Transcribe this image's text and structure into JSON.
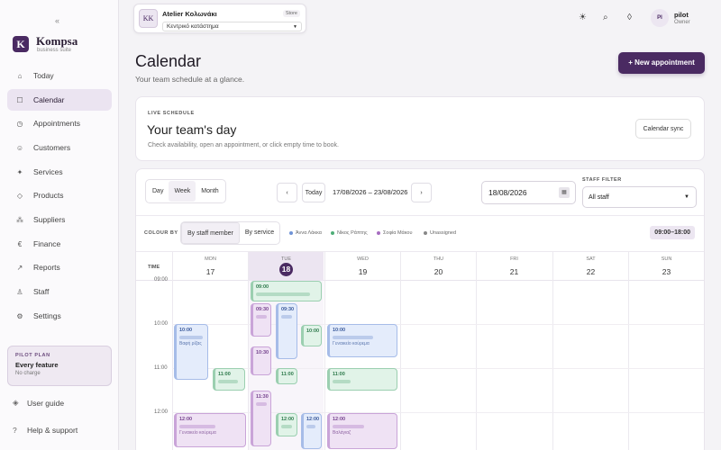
{
  "sidebar": {
    "collapse_glyph": "«",
    "logo_mark": "K",
    "brand": "Kompsa",
    "tagline": "business suite",
    "items": [
      {
        "label": "Today",
        "icon": "home-icon"
      },
      {
        "label": "Calendar",
        "icon": "calendar-icon",
        "active": true
      },
      {
        "label": "Appointments",
        "icon": "clock-icon"
      },
      {
        "label": "Customers",
        "icon": "smile-icon"
      },
      {
        "label": "Services",
        "icon": "sparkle-icon"
      },
      {
        "label": "Products",
        "icon": "box-icon"
      },
      {
        "label": "Suppliers",
        "icon": "network-icon"
      },
      {
        "label": "Finance",
        "icon": "euro-icon"
      },
      {
        "label": "Reports",
        "icon": "trend-icon"
      },
      {
        "label": "Staff",
        "icon": "user-icon"
      },
      {
        "label": "Settings",
        "icon": "gear-icon"
      }
    ],
    "plan": {
      "title": "PILOT PLAN",
      "feature": "Every feature",
      "charge": "No charge"
    },
    "footer": {
      "guide": "User guide",
      "support": "Help & support"
    }
  },
  "topbar": {
    "org_initials": "KK",
    "org_name": "Atelier Κολωνάκι",
    "org_type": "Store",
    "branch": "Κεντρικό κατάστημα",
    "user_initials": "PI",
    "user_name": "pilot",
    "user_role": "Owner"
  },
  "header": {
    "title": "Calendar",
    "subtitle": "Your team schedule at a glance.",
    "new_button": "+ New appointment"
  },
  "live": {
    "tag": "LIVE SCHEDULE",
    "title": "Your team's day",
    "subtitle": "Check availability, open an appointment, or click empty time to book.",
    "sync_button": "Calendar sync"
  },
  "calendar": {
    "views": [
      "Day",
      "Week",
      "Month"
    ],
    "active_view": "Week",
    "prev": "‹",
    "today": "Today",
    "next": "›",
    "range": "17/08/2026 – 23/08/2026",
    "date_value": "18/08/2026",
    "staff_filter_label": "STAFF FILTER",
    "staff_filter_value": "All staff",
    "colour_by_label": "COLOUR BY",
    "colour_options": [
      "By staff member",
      "By service"
    ],
    "colour_active": "By staff member",
    "legend": [
      {
        "name": "Άννα Λάκκα",
        "color": "#6f93d6"
      },
      {
        "name": "Νίκος Ράπτης",
        "color": "#4fae78"
      },
      {
        "name": "Σοφία Μάκου",
        "color": "#a66cc0"
      },
      {
        "name": "Unassigned",
        "color": "#888888"
      }
    ],
    "hours": "09:00–18:00",
    "time_header": "TIME",
    "days": [
      {
        "dow": "MON",
        "num": "17"
      },
      {
        "dow": "TUE",
        "num": "18",
        "today": true
      },
      {
        "dow": "WED",
        "num": "19"
      },
      {
        "dow": "THU",
        "num": "20"
      },
      {
        "dow": "FRI",
        "num": "21"
      },
      {
        "dow": "SAT",
        "num": "22"
      },
      {
        "dow": "SUN",
        "num": "23"
      }
    ],
    "hour_labels": [
      "09:00",
      "10:00",
      "11:00",
      "12:00"
    ],
    "appointments": [
      {
        "time": "09:00",
        "color": "green"
      },
      {
        "time": "10:00",
        "service": "Βαφή ρίζας",
        "color": "blue"
      },
      {
        "time": "09:30",
        "color": "purple"
      },
      {
        "time": "09:30",
        "color": "blue"
      },
      {
        "time": "10:00",
        "color": "green"
      },
      {
        "time": "10:00",
        "service": "Γυναικείο κούρεμα",
        "color": "blue"
      },
      {
        "time": "11:00",
        "color": "green"
      },
      {
        "time": "10:30",
        "color": "purple"
      },
      {
        "time": "11:00",
        "color": "green"
      },
      {
        "time": "11:00",
        "color": "green"
      },
      {
        "time": "11:30",
        "color": "purple"
      },
      {
        "time": "12:00",
        "service": "Γυναικείο κούρεμα",
        "color": "purple"
      },
      {
        "time": "12:00",
        "color": "green"
      },
      {
        "time": "12:00",
        "color": "blue"
      },
      {
        "time": "12:00",
        "service": "Βαλάγιαζ",
        "color": "purple"
      }
    ]
  }
}
